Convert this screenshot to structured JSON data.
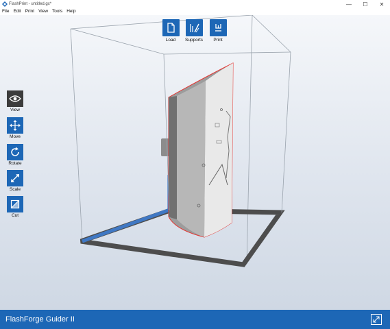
{
  "window": {
    "title": "FlashPrint - untitled.gx*",
    "minimize": "—",
    "maximize": "☐",
    "close": "✕"
  },
  "menu": [
    "File",
    "Edit",
    "Print",
    "View",
    "Tools",
    "Help"
  ],
  "toolbar": {
    "load": "Load",
    "supports": "Supports",
    "print": "Print"
  },
  "sidebar": {
    "view": "View",
    "move": "Move",
    "rotate": "Rotate",
    "scale": "Scale",
    "cut": "Cut",
    "active": "View"
  },
  "status": {
    "machine": "FlashForge Guider II"
  },
  "colors": {
    "accent": "#1d67b6",
    "active_tool": "#3c3c3c",
    "model_outline": "#e53935"
  },
  "icons": {
    "load": "file-icon",
    "supports": "supports-icon",
    "print": "print-icon",
    "view": "eye-icon",
    "move": "move-arrows-icon",
    "rotate": "rotate-icon",
    "scale": "scale-diagonal-icon",
    "cut": "cut-icon",
    "status": "collapse-icon"
  }
}
